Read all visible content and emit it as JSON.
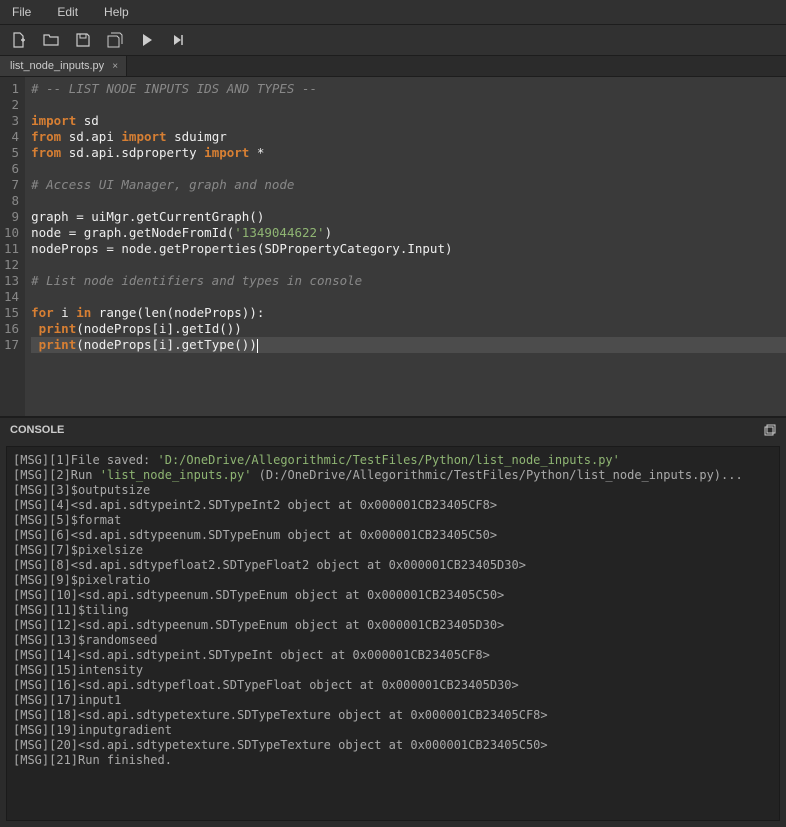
{
  "menubar": {
    "file": "File",
    "edit": "Edit",
    "help": "Help"
  },
  "toolbar": {
    "new": "new-file",
    "open": "open-folder",
    "save": "save",
    "saveall": "save-all",
    "run": "run",
    "runall": "run-all"
  },
  "tab": {
    "name": "list_node_inputs.py",
    "close": "×"
  },
  "code": {
    "lines": [
      {
        "n": 1,
        "t": "comment",
        "text": "# -- LIST NODE INPUTS IDS AND TYPES --"
      },
      {
        "n": 2,
        "t": "blank",
        "text": ""
      },
      {
        "n": 3,
        "t": "plain",
        "tokens": [
          {
            "c": "kw",
            "v": "import"
          },
          {
            "c": "ident",
            "v": " sd"
          }
        ]
      },
      {
        "n": 4,
        "t": "plain",
        "tokens": [
          {
            "c": "kw",
            "v": "from"
          },
          {
            "c": "ident",
            "v": " sd.api "
          },
          {
            "c": "kw",
            "v": "import"
          },
          {
            "c": "ident",
            "v": " sduimgr"
          }
        ]
      },
      {
        "n": 5,
        "t": "plain",
        "tokens": [
          {
            "c": "kw",
            "v": "from"
          },
          {
            "c": "ident",
            "v": " sd.api.sdproperty "
          },
          {
            "c": "kw",
            "v": "import"
          },
          {
            "c": "ident",
            "v": " *"
          }
        ]
      },
      {
        "n": 6,
        "t": "blank",
        "text": ""
      },
      {
        "n": 7,
        "t": "comment",
        "text": "# Access UI Manager, graph and node"
      },
      {
        "n": 8,
        "t": "blank",
        "text": ""
      },
      {
        "n": 9,
        "t": "plain",
        "tokens": [
          {
            "c": "ident",
            "v": "graph = uiMgr.getCurrentGraph()"
          }
        ]
      },
      {
        "n": 10,
        "t": "plain",
        "tokens": [
          {
            "c": "ident",
            "v": "node = graph.getNodeFromId("
          },
          {
            "c": "str",
            "v": "'1349044622'"
          },
          {
            "c": "ident",
            "v": ")"
          }
        ]
      },
      {
        "n": 11,
        "t": "plain",
        "tokens": [
          {
            "c": "ident",
            "v": "nodeProps = node.getProperties(SDPropertyCategory.Input)"
          }
        ]
      },
      {
        "n": 12,
        "t": "blank",
        "text": ""
      },
      {
        "n": 13,
        "t": "comment",
        "text": "# List node identifiers and types in console"
      },
      {
        "n": 14,
        "t": "blank",
        "text": ""
      },
      {
        "n": 15,
        "t": "plain",
        "tokens": [
          {
            "c": "kw",
            "v": "for"
          },
          {
            "c": "ident",
            "v": " i "
          },
          {
            "c": "kw",
            "v": "in"
          },
          {
            "c": "ident",
            "v": " range(len(nodeProps)):"
          }
        ]
      },
      {
        "n": 16,
        "t": "plain",
        "tokens": [
          {
            "c": "ident",
            "v": " "
          },
          {
            "c": "kw",
            "v": "print"
          },
          {
            "c": "ident",
            "v": "(nodeProps[i].getId())"
          }
        ]
      },
      {
        "n": 17,
        "t": "current",
        "tokens": [
          {
            "c": "ident",
            "v": " "
          },
          {
            "c": "kw",
            "v": "print"
          },
          {
            "c": "ident",
            "v": "(nodeProps[i].getType())"
          }
        ]
      }
    ]
  },
  "console": {
    "title": "CONSOLE",
    "lines": [
      {
        "pre": "[MSG][1]File saved: ",
        "str": "'D:/OneDrive/Allegorithmic/TestFiles/Python/list_node_inputs.py'",
        "post": ""
      },
      {
        "pre": "[MSG][2]Run ",
        "str": "'list_node_inputs.py'",
        "post": " (D:/OneDrive/Allegorithmic/TestFiles/Python/list_node_inputs.py)..."
      },
      {
        "pre": "[MSG][3]$outputsize",
        "str": "",
        "post": ""
      },
      {
        "pre": "[MSG][4]<sd.api.sdtypeint2.SDTypeInt2 object at 0x000001CB23405CF8>",
        "str": "",
        "post": ""
      },
      {
        "pre": "[MSG][5]$format",
        "str": "",
        "post": ""
      },
      {
        "pre": "[MSG][6]<sd.api.sdtypeenum.SDTypeEnum object at 0x000001CB23405C50>",
        "str": "",
        "post": ""
      },
      {
        "pre": "[MSG][7]$pixelsize",
        "str": "",
        "post": ""
      },
      {
        "pre": "[MSG][8]<sd.api.sdtypefloat2.SDTypeFloat2 object at 0x000001CB23405D30>",
        "str": "",
        "post": ""
      },
      {
        "pre": "[MSG][9]$pixelratio",
        "str": "",
        "post": ""
      },
      {
        "pre": "[MSG][10]<sd.api.sdtypeenum.SDTypeEnum object at 0x000001CB23405C50>",
        "str": "",
        "post": ""
      },
      {
        "pre": "[MSG][11]$tiling",
        "str": "",
        "post": ""
      },
      {
        "pre": "[MSG][12]<sd.api.sdtypeenum.SDTypeEnum object at 0x000001CB23405D30>",
        "str": "",
        "post": ""
      },
      {
        "pre": "[MSG][13]$randomseed",
        "str": "",
        "post": ""
      },
      {
        "pre": "[MSG][14]<sd.api.sdtypeint.SDTypeInt object at 0x000001CB23405CF8>",
        "str": "",
        "post": ""
      },
      {
        "pre": "[MSG][15]intensity",
        "str": "",
        "post": ""
      },
      {
        "pre": "[MSG][16]<sd.api.sdtypefloat.SDTypeFloat object at 0x000001CB23405D30>",
        "str": "",
        "post": ""
      },
      {
        "pre": "[MSG][17]input1",
        "str": "",
        "post": ""
      },
      {
        "pre": "[MSG][18]<sd.api.sdtypetexture.SDTypeTexture object at 0x000001CB23405CF8>",
        "str": "",
        "post": ""
      },
      {
        "pre": "[MSG][19]inputgradient",
        "str": "",
        "post": ""
      },
      {
        "pre": "[MSG][20]<sd.api.sdtypetexture.SDTypeTexture object at 0x000001CB23405C50>",
        "str": "",
        "post": ""
      },
      {
        "pre": "[MSG][21]Run finished.",
        "str": "",
        "post": ""
      }
    ]
  }
}
